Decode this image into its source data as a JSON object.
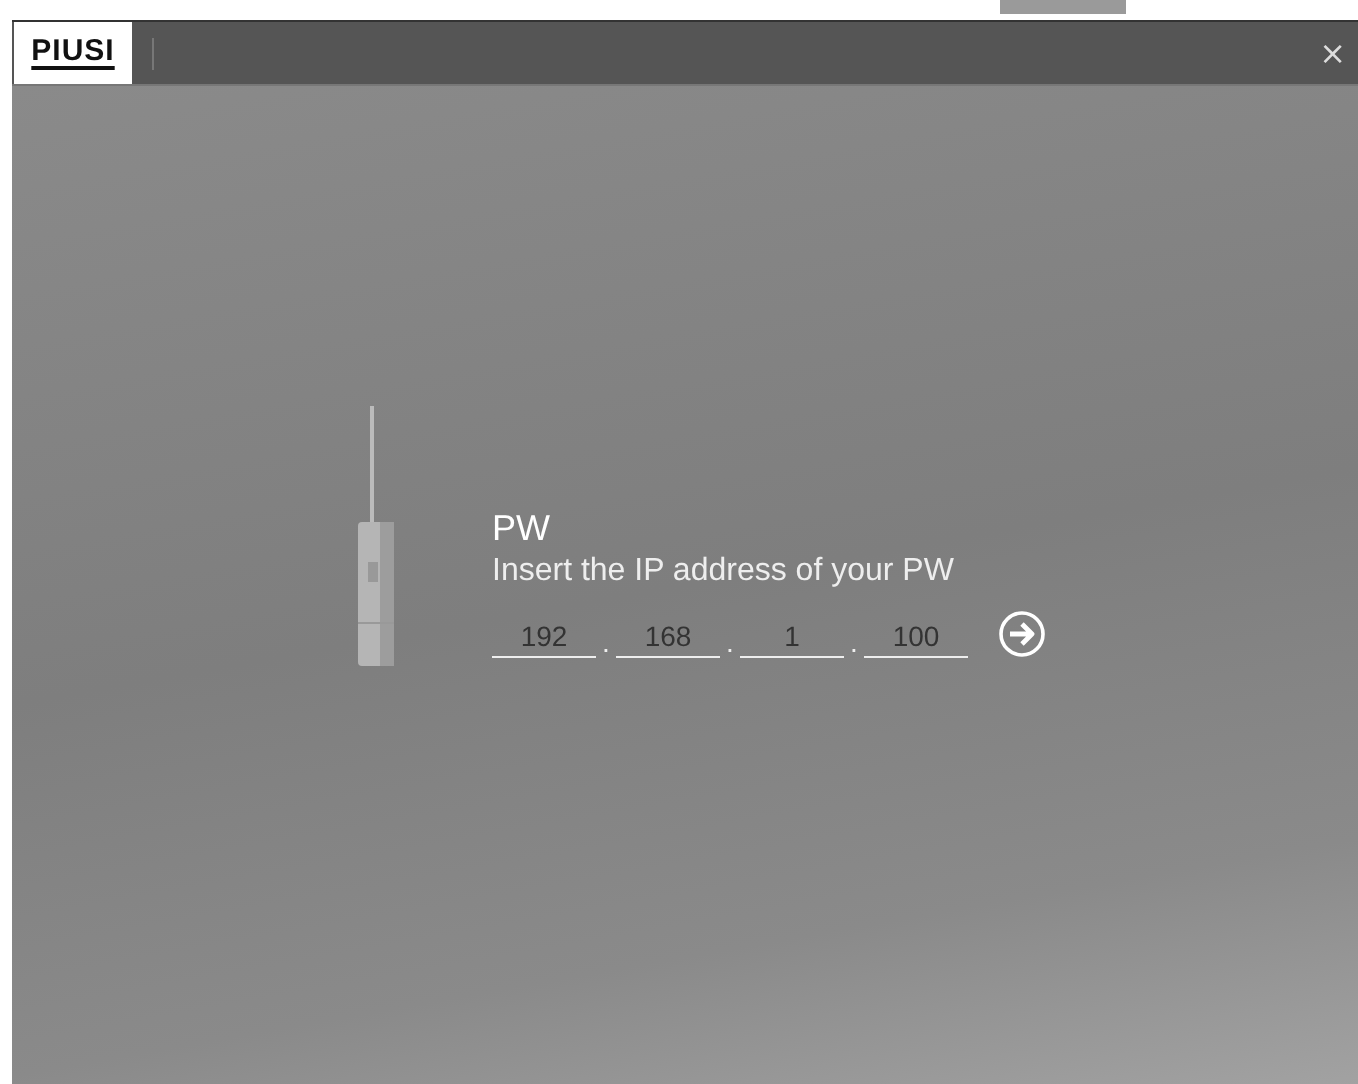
{
  "window": {
    "logo": "PIUSI",
    "close": "×"
  },
  "device": {
    "title": "PW",
    "subtitle": "Insert the IP address of your PW"
  },
  "ip_fields": [
    {
      "value": "192"
    },
    {
      "value": "168"
    },
    {
      "value": "1"
    },
    {
      "value": "100"
    }
  ],
  "separator": "."
}
